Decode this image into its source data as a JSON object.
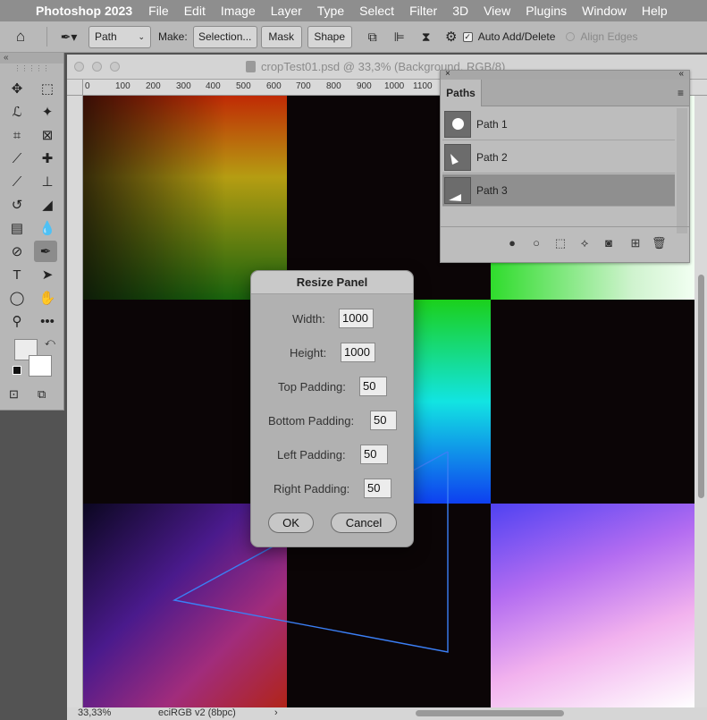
{
  "menubar": {
    "app_name": "Photoshop 2023",
    "items": [
      "File",
      "Edit",
      "Image",
      "Layer",
      "Type",
      "Select",
      "Filter",
      "3D",
      "View",
      "Plugins",
      "Window",
      "Help"
    ]
  },
  "options_bar": {
    "mode": "Path",
    "make_label": "Make:",
    "selection_button": "Selection...",
    "mask_button": "Mask",
    "shape_button": "Shape",
    "auto_add_delete_label": "Auto Add/Delete",
    "auto_add_delete_checked": true,
    "align_edges_label": "Align Edges"
  },
  "document": {
    "title": "cropTest01.psd @ 33,3% (Background, RGB/8)",
    "zoom": "33,33%",
    "color_profile": "eciRGB v2 (8bpc)",
    "ruler_labels": [
      "0",
      "100",
      "200",
      "300",
      "400",
      "500",
      "600",
      "700",
      "800",
      "900",
      "1000",
      "1100"
    ]
  },
  "paths_panel": {
    "tab": "Paths",
    "items": [
      {
        "label": "Path 1",
        "selected": false
      },
      {
        "label": "Path 2",
        "selected": false
      },
      {
        "label": "Path 3",
        "selected": true
      }
    ]
  },
  "dialog": {
    "title": "Resize Panel",
    "fields": [
      {
        "label": "Width:",
        "value": "1000"
      },
      {
        "label": "Height:",
        "value": "1000"
      },
      {
        "label": "Top Padding:",
        "value": "50"
      },
      {
        "label": "Bottom Padding:",
        "value": "50"
      },
      {
        "label": "Left Padding:",
        "value": "50"
      },
      {
        "label": "Right Padding:",
        "value": "50"
      }
    ],
    "ok_label": "OK",
    "cancel_label": "Cancel"
  },
  "colors": {
    "path_stroke": "#3b7ff5",
    "canvas_bg": "#0b0506"
  },
  "icons": {
    "tools": [
      "move-icon",
      "marquee-icon",
      "lasso-icon",
      "magic-wand-icon",
      "crop-icon",
      "frame-icon",
      "eyedropper-icon",
      "healing-icon",
      "brush-icon",
      "stamp-icon",
      "history-brush-icon",
      "eraser-icon",
      "gradient-icon",
      "blur-icon",
      "dodge-icon",
      "pen-icon",
      "type-icon",
      "path-select-icon",
      "ellipse-icon",
      "hand-icon",
      "zoom-icon",
      "more-icon"
    ],
    "paths_footer": [
      "fill-path-icon",
      "stroke-path-icon",
      "load-selection-icon",
      "make-work-path-icon",
      "add-mask-icon",
      "new-path-icon",
      "delete-path-icon"
    ]
  }
}
